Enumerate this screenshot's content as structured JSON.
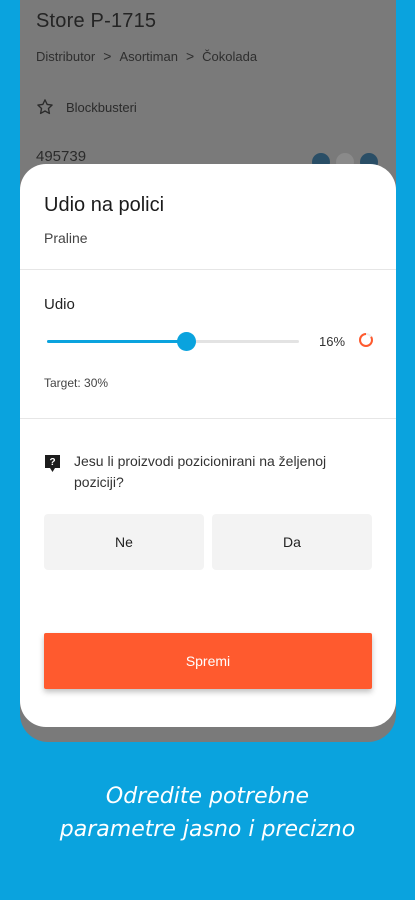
{
  "background_screen": {
    "title": "Store P-1715",
    "breadcrumb": [
      "Distributor",
      "Asortiman",
      "Čokolada"
    ],
    "breadcrumb_separator": ">",
    "section_label": "Blockbusteri",
    "section_icon": "star-outline-icon",
    "first_item_number": "495739"
  },
  "modal": {
    "title": "Udio na polici",
    "subtitle": "Praline",
    "share_label": "Udio",
    "share_percent": 16,
    "share_display": "16%",
    "target_text": "Target: 30%",
    "question": "Jesu li proizvodi pozicionirani na željenoj poziciji?",
    "question_icon": "question-bubble-icon",
    "answer_no": "Ne",
    "answer_yes": "Da",
    "save_label": "Spremi"
  },
  "caption": {
    "line1": "Odredite potrebne",
    "line2": "parametre jasno i precizno"
  },
  "colors": {
    "background": "#0aa3de",
    "accent": "#0aa3de",
    "save_button": "#ff5a2e",
    "ring": "#ff5a2e"
  }
}
